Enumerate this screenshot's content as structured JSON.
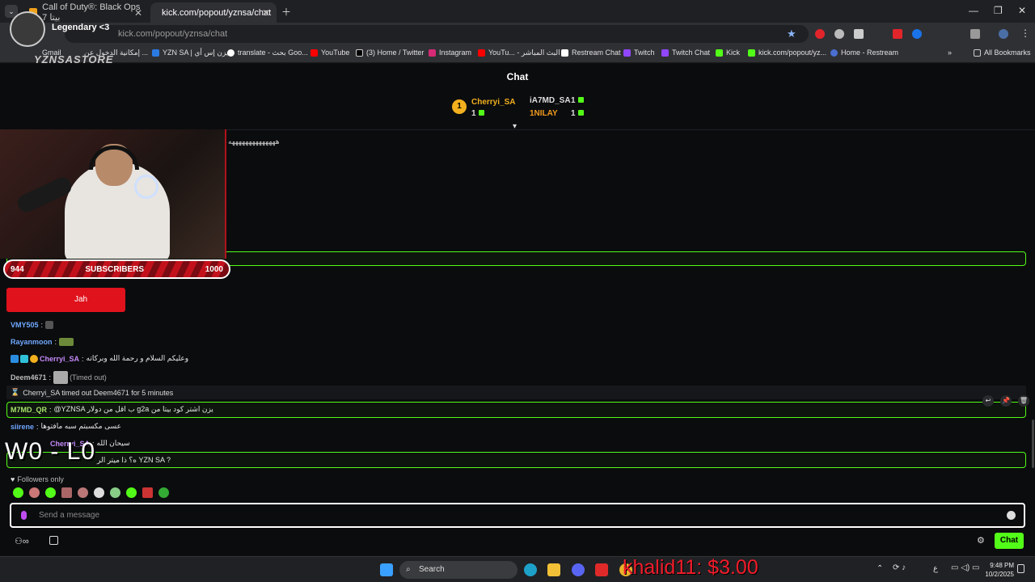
{
  "browser": {
    "tabs": [
      {
        "label": "Call of Duty®: Black Ops 7 بيتا"
      },
      {
        "label": "kick.com/popout/yznsa/chat"
      }
    ],
    "url": "kick.com/popout/yznsa/chat",
    "bookmarks": [
      "Gmail",
      "إمكانية الدخول عن ...",
      "YZN SA | يزن إس أي",
      "translate - بحث Goo...",
      "YouTube",
      "(3) Home / Twitter",
      "Instagram",
      "YouTu... - البث المباشر",
      "Restream Chat",
      "Twitch",
      "Twitch Chat",
      "Kick",
      "kick.com/popout/yz...",
      "Home - Restream"
    ],
    "all_bookmarks": "All Bookmarks"
  },
  "stream_overlay": {
    "streamer_tag": "Legendary <3",
    "store_name": "YZNSASTORE",
    "subs_current": "944",
    "subs_label": "SUBSCRIBERS",
    "subs_goal": "1000",
    "subs_progress": 0.944,
    "score": "W0 - L0",
    "donation": "khalid11: $3.00",
    "card_text": "Jah"
  },
  "chat": {
    "title": "Chat",
    "leaderboard": [
      {
        "rank": "1",
        "name": "Cherryi_SA",
        "count": "1"
      },
      {
        "name": "iA7MD_SA",
        "count": "1"
      },
      {
        "name": "1NILAY",
        "count": "1"
      }
    ],
    "partial_line": "ههههههههههههههه",
    "messages": [
      {
        "user": "VMY505",
        "text": ""
      },
      {
        "user": "Rayanmoon",
        "text": ""
      },
      {
        "user": "Cherryi_SA",
        "text": "وعليكم السلام و رحمة الله وبركاته"
      },
      {
        "user": "Deem4671",
        "text": "(Timed out)"
      },
      {
        "system": "Cherryi_SA timed out Deem4671 for 5 minutes"
      },
      {
        "user": "M7MD_QR",
        "text": "@YZNSA ب اقل من دولار g2a يزن اشتر كود بيتا من"
      },
      {
        "user": "siirene",
        "text": "عسى مكسبتم سبه مافتوها"
      },
      {
        "user": "Cherryi_SA",
        "text": "سيحان الله"
      },
      {
        "user": "",
        "text": "ه؟ ذا ميتر الر YZN SA ?"
      }
    ],
    "followers_only": "Followers only",
    "composer_placeholder": "Send a message",
    "chat_button": "Chat"
  },
  "taskbar": {
    "search_label": "Search",
    "time": "9:48 PM",
    "date": "10/2/2025",
    "lang": "ع"
  }
}
